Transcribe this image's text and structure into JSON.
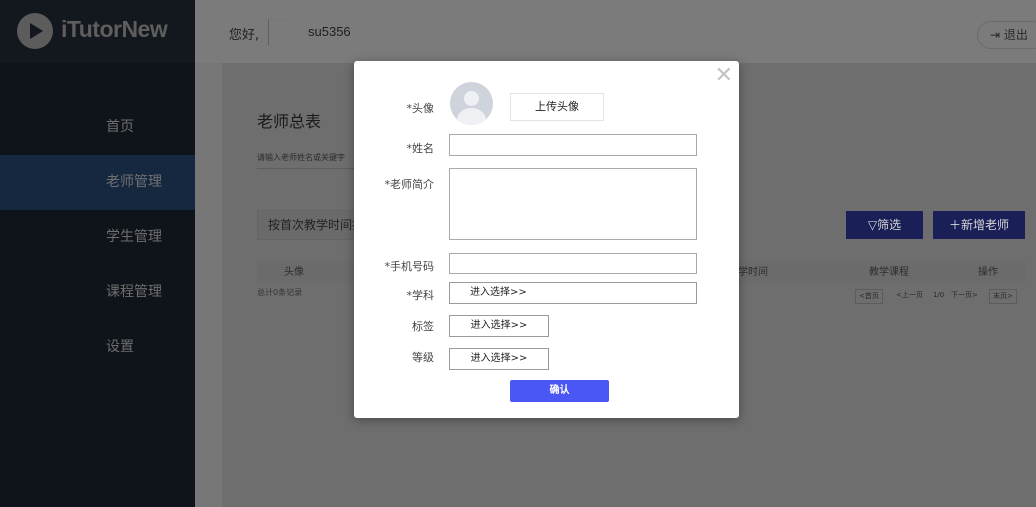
{
  "app": {
    "logo_text": "iTutorNew"
  },
  "sidebar": {
    "items": [
      {
        "label": "首页"
      },
      {
        "label": "老师管理"
      },
      {
        "label": "学生管理"
      },
      {
        "label": "课程管理"
      },
      {
        "label": "设置"
      }
    ]
  },
  "header": {
    "greeting": "您好,",
    "username": "su5356",
    "logout_label": "退出"
  },
  "main": {
    "title": "老师总表",
    "search_placeholder": "请输入老师姓名或关键字",
    "sort_label": "按首次教学时间排",
    "filter_label": "筛选",
    "add_label": "新增老师",
    "columns": [
      "头像",
      "学时间",
      "教学课程",
      "操作"
    ],
    "total_text": "总计0条记录",
    "pager": {
      "first": "<首页",
      "prev": "<上一页",
      "page": "1/0",
      "next": "下一页>",
      "last": "末页>"
    }
  },
  "modal": {
    "avatar_label": "*头像",
    "upload_label": "上传头像",
    "name_label": "*姓名",
    "name_value": "",
    "intro_label": "*老师简介",
    "intro_value": "",
    "phone_label": "*手机号码",
    "phone_value": "",
    "subject_label": "*学科",
    "subject_button": "进入选择>>",
    "tag_label": "标签",
    "tag_button": "进入选择>>",
    "level_label": "等级",
    "level_button": "进入选择>>",
    "confirm_label": "确认",
    "close_symbol": "✕"
  },
  "colors": {
    "accent": "#4a57f5",
    "sidebar_bg": "#0f131a",
    "sidebar_active": "#15283f"
  }
}
